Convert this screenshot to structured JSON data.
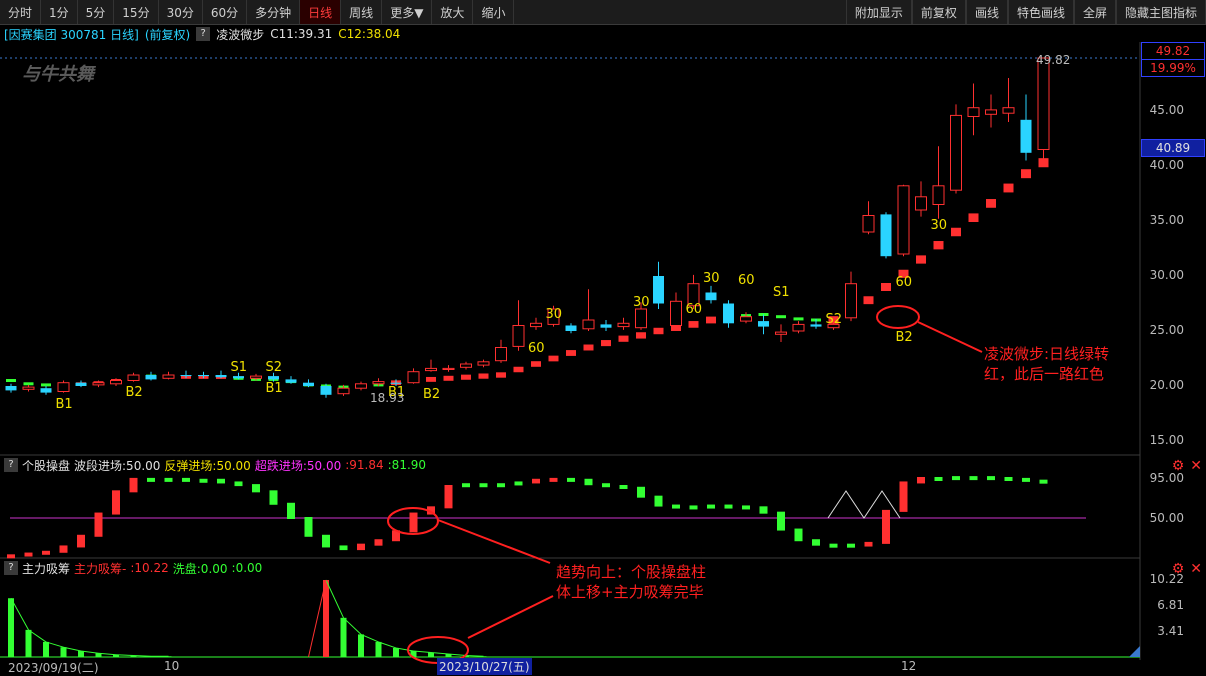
{
  "toolbar": {
    "items": [
      "分时",
      "1分",
      "5分",
      "15分",
      "30分",
      "60分",
      "多分钟",
      "日线",
      "周线",
      "更多▼",
      "放大",
      "缩小"
    ],
    "active": "日线",
    "right_items": [
      "附加显示",
      "前复权",
      "画线",
      "特色画线",
      "全屏",
      "隐藏主图指标"
    ]
  },
  "title": {
    "stock": "[因赛集团 300781 日线]",
    "adjust": "(前复权)",
    "indicator": "凌波微步",
    "c1": "C11:39.31",
    "c2": "C12:38.04",
    "watermark": "与牛共舞"
  },
  "price_axis": {
    "ticks": [
      "45.00",
      "40.00",
      "35.00",
      "30.00",
      "25.00",
      "20.00",
      "15.00"
    ],
    "top_price": "49.82",
    "top_pct": "19.99%",
    "cursor_price": "40.89",
    "high_label": "49.82",
    "low_label": "18.93"
  },
  "panel2": {
    "name": "个股操盘",
    "l1": "波段进场:50.00",
    "l2": "反弹进场:50.00",
    "l3": "超跌进场:50.00",
    "v1": ":91.84",
    "v2": ":81.90",
    "ticks": [
      "95.00",
      "50.00"
    ]
  },
  "panel3": {
    "name": "主力吸筹",
    "l1": "主力吸筹-",
    "v1": ":10.22",
    "l2": "洗盘:0.00",
    "v2": ":0.00",
    "ticks": [
      "10.22",
      "6.81",
      "3.41"
    ]
  },
  "date_axis": {
    "start": "2023/09/19(二)",
    "m1": "10",
    "cursor": "2023/10/27(五)",
    "m2": "12"
  },
  "annotations": {
    "a1_line1": "凌波微步:日线绿转",
    "a1_line2": "红，此后一路红色",
    "a2_line1": "趋势向上：个股操盘柱",
    "a2_line2": "体上移+主力吸筹完毕"
  },
  "signals": {
    "b1": "B1",
    "b2": "B2",
    "s1": "S1",
    "s2": "S2",
    "n30": "30",
    "n60": "60"
  },
  "colors": {
    "up": "#ff3030",
    "down": "#2ad4ff",
    "green": "#33ff33",
    "magenta": "#cc33cc",
    "yellow": "#f0e000"
  },
  "chart_data": {
    "type": "candlestick",
    "candles": [
      [
        20.0,
        19.6,
        20.2,
        19.4
      ],
      [
        19.7,
        19.9,
        20.1,
        19.5
      ],
      [
        19.8,
        19.4,
        20.0,
        19.2
      ],
      [
        19.5,
        20.3,
        20.5,
        19.4
      ],
      [
        20.3,
        20.0,
        20.5,
        19.9
      ],
      [
        20.1,
        20.3,
        20.5,
        19.9
      ],
      [
        20.2,
        20.5,
        20.7,
        20.0
      ],
      [
        20.5,
        21.0,
        21.2,
        20.4
      ],
      [
        21.0,
        20.6,
        21.3,
        20.5
      ],
      [
        20.7,
        21.0,
        21.3,
        20.6
      ],
      [
        21.0,
        20.9,
        21.4,
        20.7
      ],
      [
        21.0,
        20.9,
        21.3,
        20.7
      ],
      [
        21.0,
        20.8,
        21.4,
        20.7
      ],
      [
        20.9,
        20.7,
        21.2,
        20.6
      ],
      [
        20.7,
        20.9,
        21.1,
        20.5
      ],
      [
        20.9,
        20.6,
        21.2,
        20.4
      ],
      [
        20.6,
        20.3,
        20.9,
        20.2
      ],
      [
        20.3,
        20.0,
        20.6,
        19.9
      ],
      [
        20.0,
        19.2,
        20.2,
        18.93
      ],
      [
        19.3,
        19.8,
        20.1,
        19.1
      ],
      [
        19.8,
        20.2,
        20.4,
        19.6
      ],
      [
        20.2,
        20.4,
        20.7,
        20.0
      ],
      [
        20.3,
        20.2,
        20.6,
        20.0
      ],
      [
        20.3,
        21.3,
        21.6,
        20.2
      ],
      [
        21.4,
        21.6,
        22.4,
        21.3
      ],
      [
        21.5,
        21.6,
        21.9,
        21.3
      ],
      [
        21.7,
        22.0,
        22.2,
        21.5
      ],
      [
        21.9,
        22.2,
        22.4,
        21.7
      ],
      [
        22.3,
        23.5,
        24.2,
        22.1
      ],
      [
        23.6,
        25.5,
        27.8,
        23.2
      ],
      [
        25.4,
        25.7,
        26.2,
        25.1
      ],
      [
        25.6,
        27.0,
        27.3,
        25.4
      ],
      [
        25.5,
        25.0,
        25.7,
        24.8
      ],
      [
        25.2,
        26.0,
        28.8,
        25.0
      ],
      [
        25.6,
        25.3,
        26.0,
        25.0
      ],
      [
        25.4,
        25.7,
        26.2,
        25.1
      ],
      [
        25.3,
        27.0,
        27.6,
        25.1
      ],
      [
        30.0,
        27.5,
        31.3,
        27.0
      ],
      [
        25.5,
        27.7,
        28.5,
        25.2
      ],
      [
        27.3,
        29.3,
        30.1,
        27.0
      ],
      [
        28.5,
        27.8,
        29.1,
        27.5
      ],
      [
        27.5,
        25.7,
        27.8,
        25.3
      ],
      [
        25.9,
        26.3,
        26.7,
        25.7
      ],
      [
        25.9,
        25.4,
        26.5,
        24.7
      ],
      [
        24.7,
        24.9,
        25.6,
        24.0
      ],
      [
        25.0,
        25.6,
        25.9,
        24.8
      ],
      [
        25.6,
        25.4,
        26.1,
        25.2
      ],
      [
        25.3,
        25.6,
        26.1,
        25.1
      ],
      [
        26.2,
        29.3,
        30.4,
        25.9
      ],
      [
        34.0,
        35.5,
        36.8,
        33.8
      ],
      [
        35.6,
        31.8,
        35.8,
        31.6
      ],
      [
        32.0,
        38.2,
        38.3,
        31.8
      ],
      [
        36.0,
        37.2,
        38.6,
        35.4
      ],
      [
        36.5,
        38.2,
        41.8,
        35.2
      ],
      [
        37.8,
        44.6,
        45.6,
        37.5
      ],
      [
        44.5,
        45.3,
        47.5,
        42.8
      ],
      [
        44.7,
        45.1,
        46.5,
        43.5
      ],
      [
        44.8,
        45.3,
        48.0,
        44.0
      ],
      [
        44.2,
        41.2,
        46.5,
        40.5
      ],
      [
        41.5,
        49.82,
        49.82,
        40.0
      ]
    ],
    "lingbo": [
      [
        20.5,
        "g"
      ],
      [
        20.2,
        "g"
      ],
      [
        20.1,
        "g"
      ],
      [
        20.0,
        "r"
      ],
      [
        20.2,
        "r"
      ],
      [
        20.3,
        "r"
      ],
      [
        20.5,
        "r"
      ],
      [
        20.7,
        "r"
      ],
      [
        20.9,
        "g"
      ],
      [
        20.9,
        "r"
      ],
      [
        20.8,
        "r"
      ],
      [
        20.8,
        "r"
      ],
      [
        20.8,
        "r"
      ],
      [
        20.7,
        "g"
      ],
      [
        20.6,
        "g"
      ],
      [
        20.6,
        "g"
      ],
      [
        20.4,
        "g"
      ],
      [
        20.1,
        "g"
      ],
      [
        20.0,
        "g"
      ],
      [
        19.9,
        "g"
      ],
      [
        20.0,
        "g"
      ],
      [
        20.1,
        "g"
      ],
      [
        20.3,
        "r"
      ],
      [
        20.5,
        "r"
      ],
      [
        20.6,
        "r"
      ],
      [
        20.7,
        "r"
      ],
      [
        20.8,
        "r"
      ],
      [
        20.9,
        "r"
      ],
      [
        21.0,
        "r"
      ],
      [
        21.5,
        "r"
      ],
      [
        22.0,
        "r"
      ],
      [
        22.5,
        "r"
      ],
      [
        23.0,
        "r"
      ],
      [
        23.5,
        "r"
      ],
      [
        23.9,
        "r"
      ],
      [
        24.3,
        "r"
      ],
      [
        24.6,
        "r"
      ],
      [
        25.0,
        "r"
      ],
      [
        25.3,
        "r"
      ],
      [
        25.6,
        "r"
      ],
      [
        26.0,
        "r"
      ],
      [
        26.3,
        "g"
      ],
      [
        26.4,
        "g"
      ],
      [
        26.5,
        "g"
      ],
      [
        26.3,
        "g"
      ],
      [
        26.1,
        "g"
      ],
      [
        26.0,
        "g"
      ],
      [
        26.0,
        "r"
      ],
      [
        26.7,
        "r"
      ],
      [
        27.8,
        "r"
      ],
      [
        29.0,
        "r"
      ],
      [
        30.2,
        "r"
      ],
      [
        31.5,
        "r"
      ],
      [
        32.8,
        "r"
      ],
      [
        34.0,
        "r"
      ],
      [
        35.3,
        "r"
      ],
      [
        36.6,
        "r"
      ],
      [
        38.0,
        "r"
      ],
      [
        39.3,
        "r"
      ],
      [
        40.3,
        "r"
      ]
    ],
    "caopan": [
      [
        8,
        "r"
      ],
      [
        10,
        "r"
      ],
      [
        12,
        "r"
      ],
      [
        18,
        "r"
      ],
      [
        30,
        "r"
      ],
      [
        55,
        "r"
      ],
      [
        80,
        "r"
      ],
      [
        94,
        "r"
      ],
      [
        94,
        "g"
      ],
      [
        94,
        "g"
      ],
      [
        92,
        "g"
      ],
      [
        93,
        "g"
      ],
      [
        90,
        "g"
      ],
      [
        87,
        "g"
      ],
      [
        80,
        "g"
      ],
      [
        66,
        "g"
      ],
      [
        50,
        "g"
      ],
      [
        30,
        "g"
      ],
      [
        18,
        "g"
      ],
      [
        15,
        "g"
      ],
      [
        20,
        "r"
      ],
      [
        25,
        "r"
      ],
      [
        35,
        "r"
      ],
      [
        55,
        "r"
      ],
      [
        62,
        "r"
      ],
      [
        86,
        "r"
      ],
      [
        88,
        "g"
      ],
      [
        88,
        "g"
      ],
      [
        88,
        "g"
      ],
      [
        90,
        "g"
      ],
      [
        93,
        "r"
      ],
      [
        94,
        "r"
      ],
      [
        93,
        "g"
      ],
      [
        88,
        "g"
      ],
      [
        86,
        "g"
      ],
      [
        84,
        "g"
      ],
      [
        74,
        "g"
      ],
      [
        64,
        "g"
      ],
      [
        62,
        "g"
      ],
      [
        63,
        "g"
      ],
      [
        64,
        "g"
      ],
      [
        63,
        "g"
      ],
      [
        62,
        "g"
      ],
      [
        56,
        "g"
      ],
      [
        37,
        "g"
      ],
      [
        25,
        "g"
      ],
      [
        20,
        "g"
      ],
      [
        20,
        "g"
      ],
      [
        19,
        "g"
      ],
      [
        22,
        "r"
      ],
      [
        58,
        "r"
      ],
      [
        90,
        "r"
      ],
      [
        95,
        "r"
      ],
      [
        94,
        "g"
      ],
      [
        96,
        "g"
      ],
      [
        96,
        "g"
      ],
      [
        95,
        "g"
      ],
      [
        94,
        "g"
      ],
      [
        92,
        "g"
      ],
      [
        90,
        "g"
      ]
    ],
    "xichou": [
      7.8,
      3.6,
      2.0,
      1.3,
      0.8,
      0.5,
      0.3,
      0.2,
      0.1,
      0.1,
      0,
      0,
      0,
      0,
      0,
      0,
      0,
      0,
      10.22,
      5.2,
      3.0,
      2.0,
      1.2,
      0.8,
      0.6,
      0.4,
      0.2,
      0.1,
      0,
      0
    ]
  }
}
